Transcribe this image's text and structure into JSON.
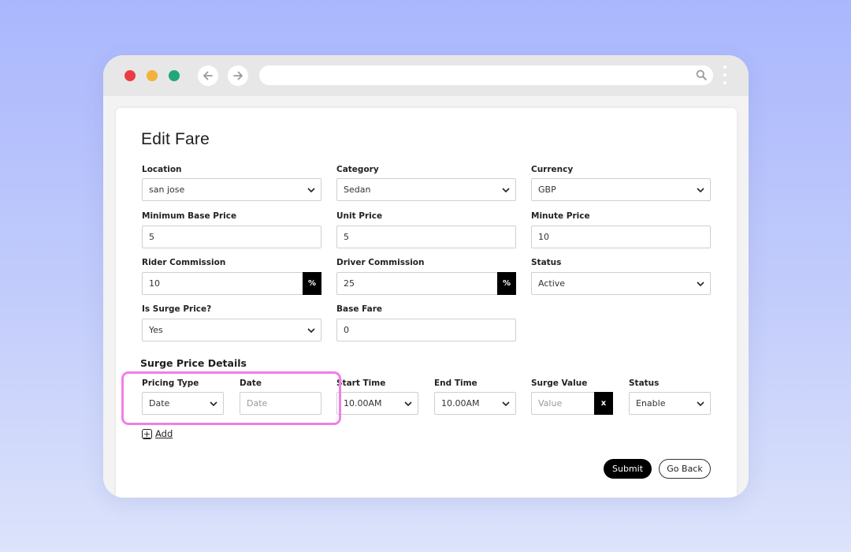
{
  "page": {
    "title": "Edit Fare"
  },
  "form": {
    "location": {
      "label": "Location",
      "value": "san jose"
    },
    "category": {
      "label": "Category",
      "value": "Sedan"
    },
    "currency": {
      "label": "Currency",
      "value": "GBP"
    },
    "min_base_price": {
      "label": "Minimum Base Price",
      "value": "5"
    },
    "unit_price": {
      "label": "Unit Price",
      "value": "5"
    },
    "minute_price": {
      "label": "Minute Price",
      "value": "10"
    },
    "rider_commission": {
      "label": "Rider Commission",
      "value": "10",
      "addon": "%"
    },
    "driver_commission": {
      "label": "Driver Commission",
      "value": "25",
      "addon": "%"
    },
    "status": {
      "label": "Status",
      "value": "Active"
    },
    "is_surge": {
      "label": "Is Surge Price?",
      "value": "Yes"
    },
    "base_fare": {
      "label": "Base Fare",
      "value": "0"
    }
  },
  "surge": {
    "title": "Surge Price Details",
    "pricing_type": {
      "label": "Pricing Type",
      "value": "Date"
    },
    "date": {
      "label": "Date",
      "placeholder": "Date"
    },
    "start_time": {
      "label": "Start Time",
      "value": "10.00AM"
    },
    "end_time": {
      "label": "End Time",
      "value": "10.00AM"
    },
    "surge_value": {
      "label": "Surge Value",
      "placeholder": "Value",
      "remove": "x"
    },
    "status": {
      "label": "Status",
      "value": "Enable"
    },
    "add_label": "Add"
  },
  "actions": {
    "submit": "Submit",
    "go_back": "Go Back"
  },
  "colors": {
    "highlight": "#f27ee8",
    "accent": "#000000"
  }
}
